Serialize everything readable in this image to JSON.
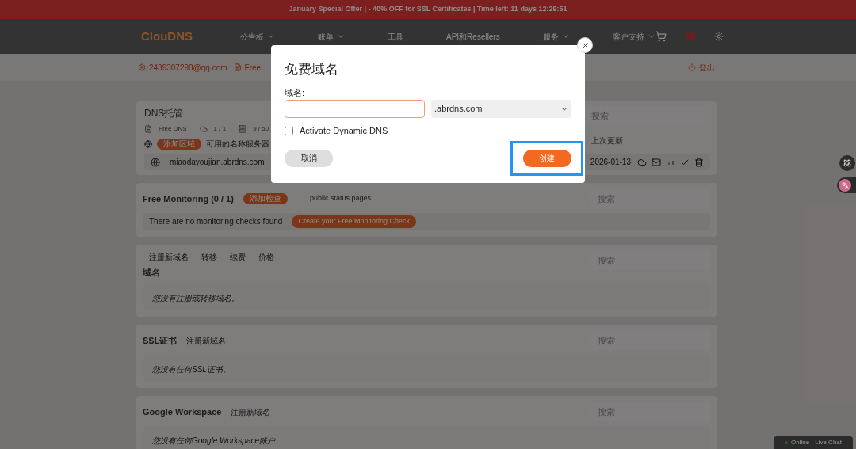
{
  "banner": {
    "text": "January Special Offer | - 40% OFF for SSL Certificates | Time left: 11 days 12:29:51"
  },
  "nav": {
    "logo": "ClouDNS",
    "items": [
      {
        "label": "公告板",
        "dropdown": true
      },
      {
        "label": "账单",
        "dropdown": true
      },
      {
        "label": "工具",
        "dropdown": false
      },
      {
        "label": "API和Resellers",
        "dropdown": false
      },
      {
        "label": "服务",
        "dropdown": true
      },
      {
        "label": "客户支持",
        "dropdown": true
      }
    ]
  },
  "account_bar": {
    "email": "2439307298@qq.com",
    "plan": "Free",
    "logout": "登出"
  },
  "dns_hosting": {
    "title": "DNS托管",
    "stats": [
      {
        "kind": "plan",
        "text": "Free DNS"
      },
      {
        "kind": "zones",
        "text": "1 / 1"
      },
      {
        "kind": "records",
        "text": "9 / 50"
      }
    ],
    "badge": "添加区域",
    "nameservers": "可用的名称服务器",
    "search": {
      "placeholder": "搜索"
    },
    "column": "上次更新",
    "rows": [
      {
        "domain": "miaodayoujian.abrdns.com",
        "updated": "2026-01-13"
      }
    ]
  },
  "monitoring": {
    "title": "Free Monitoring (0 / 1)",
    "badge": "添加检查",
    "link": "public status pages",
    "search": {
      "placeholder": "搜索"
    },
    "empty": "There are no monitoring checks found",
    "action": "Create your Free Monitoring Check"
  },
  "domains": {
    "tabs": [
      "注册新域名",
      "转移",
      "续费",
      "价格"
    ],
    "title": "域名",
    "search": {
      "placeholder": "搜索"
    },
    "empty": "您没有注册或转移域名。"
  },
  "ssl": {
    "title": "SSL证书",
    "link": "注册新域名",
    "search": {
      "placeholder": "搜索"
    },
    "empty": "您没有任何SSL证书。"
  },
  "google": {
    "title": "Google Workspace",
    "link": "注册新域名",
    "search": {
      "placeholder": "搜索"
    },
    "empty": "您没有任何Google Workspace账户"
  },
  "chat": {
    "label": "Online - Live Chat"
  },
  "modal": {
    "title": "免费域名",
    "field_label": "域名:",
    "zone": ".abrdns.com",
    "dynamic_dns": {
      "label": "Activate Dynamic DNS",
      "checked": false
    },
    "cancel": "取消",
    "create": {
      "label": "创建",
      "highlighted": true
    }
  }
}
